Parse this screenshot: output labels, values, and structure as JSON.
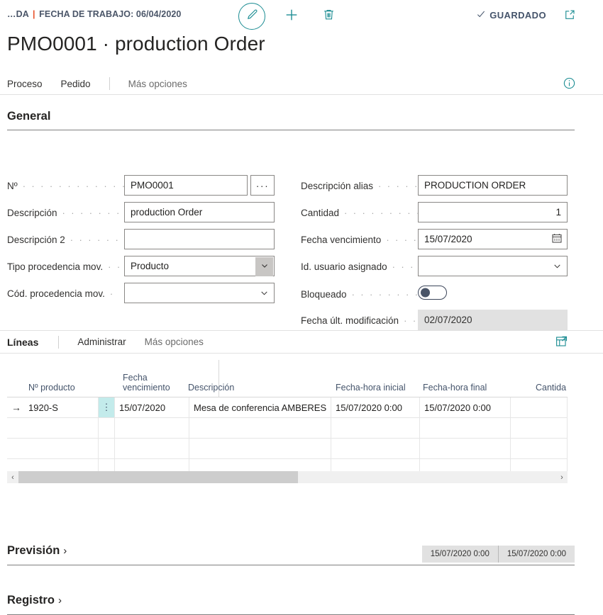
{
  "topbar": {
    "company_prefix": "…DA",
    "separator": "|",
    "workdate_label": "FECHA DE TRABAJO: 06/04/2020",
    "edit_icon": "pencil-icon",
    "new_icon": "plus-icon",
    "delete_icon": "trash-icon",
    "saved_check": "✓",
    "saved_label": "GUARDADO",
    "open_new_window_icon": "open-in-new-window-icon"
  },
  "page": {
    "title": "PMO0001 · production Order"
  },
  "action_menu": {
    "items": [
      {
        "label": "Proceso",
        "muted": false
      },
      {
        "label": "Pedido",
        "muted": false
      },
      {
        "label": "Más opciones",
        "muted": true
      }
    ],
    "info_icon": "info-icon"
  },
  "general": {
    "heading": "General",
    "left_fields": [
      {
        "label": "Nº",
        "value": "PMO0001",
        "assist": "···"
      },
      {
        "label": "Descripción",
        "value": "production Order"
      },
      {
        "label": "Descripción 2",
        "value": ""
      },
      {
        "label": "Tipo procedencia mov.",
        "value": "Producto"
      },
      {
        "label": "Cód. procedencia mov.",
        "value": ""
      }
    ],
    "right_fields": [
      {
        "label": "Descripción alias",
        "value": "PRODUCTION ORDER"
      },
      {
        "label": "Cantidad",
        "value": "1"
      },
      {
        "label": "Fecha vencimiento",
        "value": "15/07/2020"
      },
      {
        "label": "Id. usuario asignado",
        "value": ""
      },
      {
        "label": "Bloqueado",
        "value": ""
      },
      {
        "label": "Fecha últ. modificación",
        "value": "02/07/2020"
      }
    ],
    "assist_icon": "ellipsis-icon",
    "calendar_icon": "calendar-icon",
    "dropdown_icon": "chevron-down-icon",
    "toggle_state": "off"
  },
  "lines": {
    "tab_label": "Líneas",
    "menu": [
      {
        "label": "Administrar",
        "muted": false
      },
      {
        "label": "Más opciones",
        "muted": true
      }
    ],
    "expand_icon": "expand-grid-icon",
    "columns": [
      "Nº producto",
      "Fecha\nvencimiento",
      "Descripción",
      "Fecha-hora inicial",
      "Fecha-hora final",
      "Cantida"
    ],
    "rows": [
      {
        "indicator": "→",
        "product_no": "1920-S",
        "dots": "⋮",
        "due_date": "15/07/2020",
        "description": "Mesa de conferencia AMBERES",
        "start_datetime": "15/07/2020 0:00",
        "end_datetime": "15/07/2020 0:00",
        "quantity": ""
      },
      {
        "indicator": "",
        "product_no": "",
        "dots": "",
        "due_date": "",
        "description": "",
        "start_datetime": "",
        "end_datetime": "",
        "quantity": ""
      },
      {
        "indicator": "",
        "product_no": "",
        "dots": "",
        "due_date": "",
        "description": "",
        "start_datetime": "",
        "end_datetime": "",
        "quantity": ""
      },
      {
        "indicator": "",
        "product_no": "",
        "dots": "",
        "due_date": "",
        "description": "",
        "start_datetime": "",
        "end_datetime": "",
        "quantity": ""
      }
    ],
    "scroll_left": "‹",
    "scroll_right": "›"
  },
  "prevision": {
    "title": "Previsión",
    "chevron": "›",
    "chips": [
      "15/07/2020 0:00",
      "15/07/2020 0:00"
    ]
  },
  "registro": {
    "title": "Registro",
    "chevron": "›"
  },
  "colors": {
    "teal": "#1c8d93",
    "accent_orange": "#e8502a",
    "row_dots_bg": "#c3ebeb",
    "readonly_bg": "#e1e1e1"
  }
}
